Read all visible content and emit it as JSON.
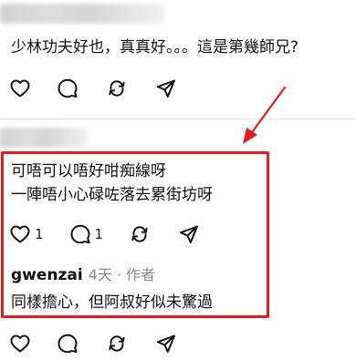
{
  "comments": [
    {
      "text": "少林功夫好也，真真好。。。這是第幾師兄?",
      "likes": "",
      "replies": ""
    },
    {
      "lines": [
        "可唔可以唔好咁痴線呀",
        "一陣唔小心碌咗落去累街坊呀"
      ],
      "likes": "1",
      "replies": "1"
    }
  ],
  "reply": {
    "author": "gwenzai",
    "time": "4天",
    "separator": "·",
    "role": "作者",
    "text": "同樣擔心，但阿叔好似未驚過"
  },
  "icons": [
    "heart-icon",
    "comment-icon",
    "repost-icon",
    "share-icon"
  ],
  "colors": {
    "highlight": "#e11d23",
    "arrow": "#e11d23",
    "meta_text": "#8a8a8a"
  }
}
